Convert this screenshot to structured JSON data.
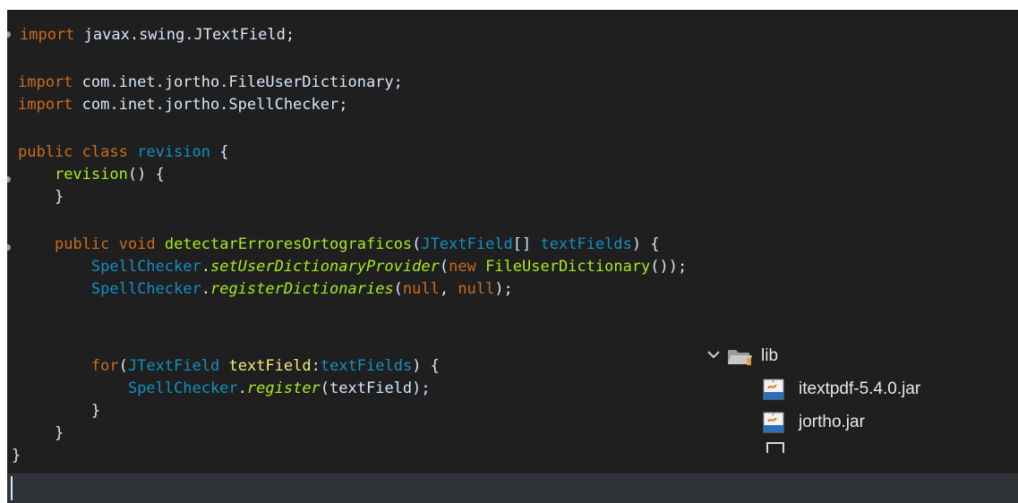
{
  "code": {
    "line1": {
      "kw": "import",
      "rest": " javax.swing.JTextField;"
    },
    "line3": {
      "kw": "import",
      "rest": " com.inet.jortho.FileUserDictionary;"
    },
    "line4": {
      "kw": "import",
      "rest": " com.inet.jortho.SpellChecker;"
    },
    "line6": {
      "kw1": "public",
      "kw2": "class",
      "cls": "revision",
      "brace": "{"
    },
    "line7": {
      "fn": "revision",
      "rest": "() {"
    },
    "line8": {
      "text": "}"
    },
    "line10": {
      "kw1": "public",
      "kw2": "void",
      "fn": "detectarErroresOrtograficos",
      "p1": "(",
      "type": "JTextField",
      "arr": "[] ",
      "param": "textFields",
      "end": ") {"
    },
    "line11": {
      "cls": "SpellChecker",
      "dot": ".",
      "method": "setUserDictionaryProvider",
      "p1": "(",
      "kw": "new",
      "ctor": "FileUserDictionary",
      "end": "());"
    },
    "line12": {
      "cls": "SpellChecker",
      "dot": ".",
      "method": "registerDictionaries",
      "p1": "(",
      "null1": "null",
      "comma": ", ",
      "null2": "null",
      "end": ");"
    },
    "line15": {
      "kw": "for",
      "p1": "(",
      "type": "JTextField",
      "var": "textField",
      "colon": ":",
      "iter": "textFields",
      "end": ") {"
    },
    "line16": {
      "cls": "SpellChecker",
      "dot": ".",
      "method": "register",
      "args": "(textField);"
    },
    "line17": {
      "text": "}"
    },
    "line18": {
      "text": "}"
    },
    "line19": {
      "text": "}"
    }
  },
  "package_tree": {
    "folder": {
      "label": "lib",
      "icon": "library-folder-icon"
    },
    "items": [
      {
        "label": "itextpdf-5.4.0.jar",
        "icon": "jar-file-icon"
      },
      {
        "label": "jortho.jar",
        "icon": "jar-file-icon"
      }
    ]
  },
  "colors": {
    "background": "#1f1f1f",
    "keyword": "#cc6c1d",
    "class": "#1290c3",
    "method": "#a7ec21",
    "variable": "#f3ec79",
    "text": "#d9e8f7",
    "current_line": "#2f3337"
  }
}
